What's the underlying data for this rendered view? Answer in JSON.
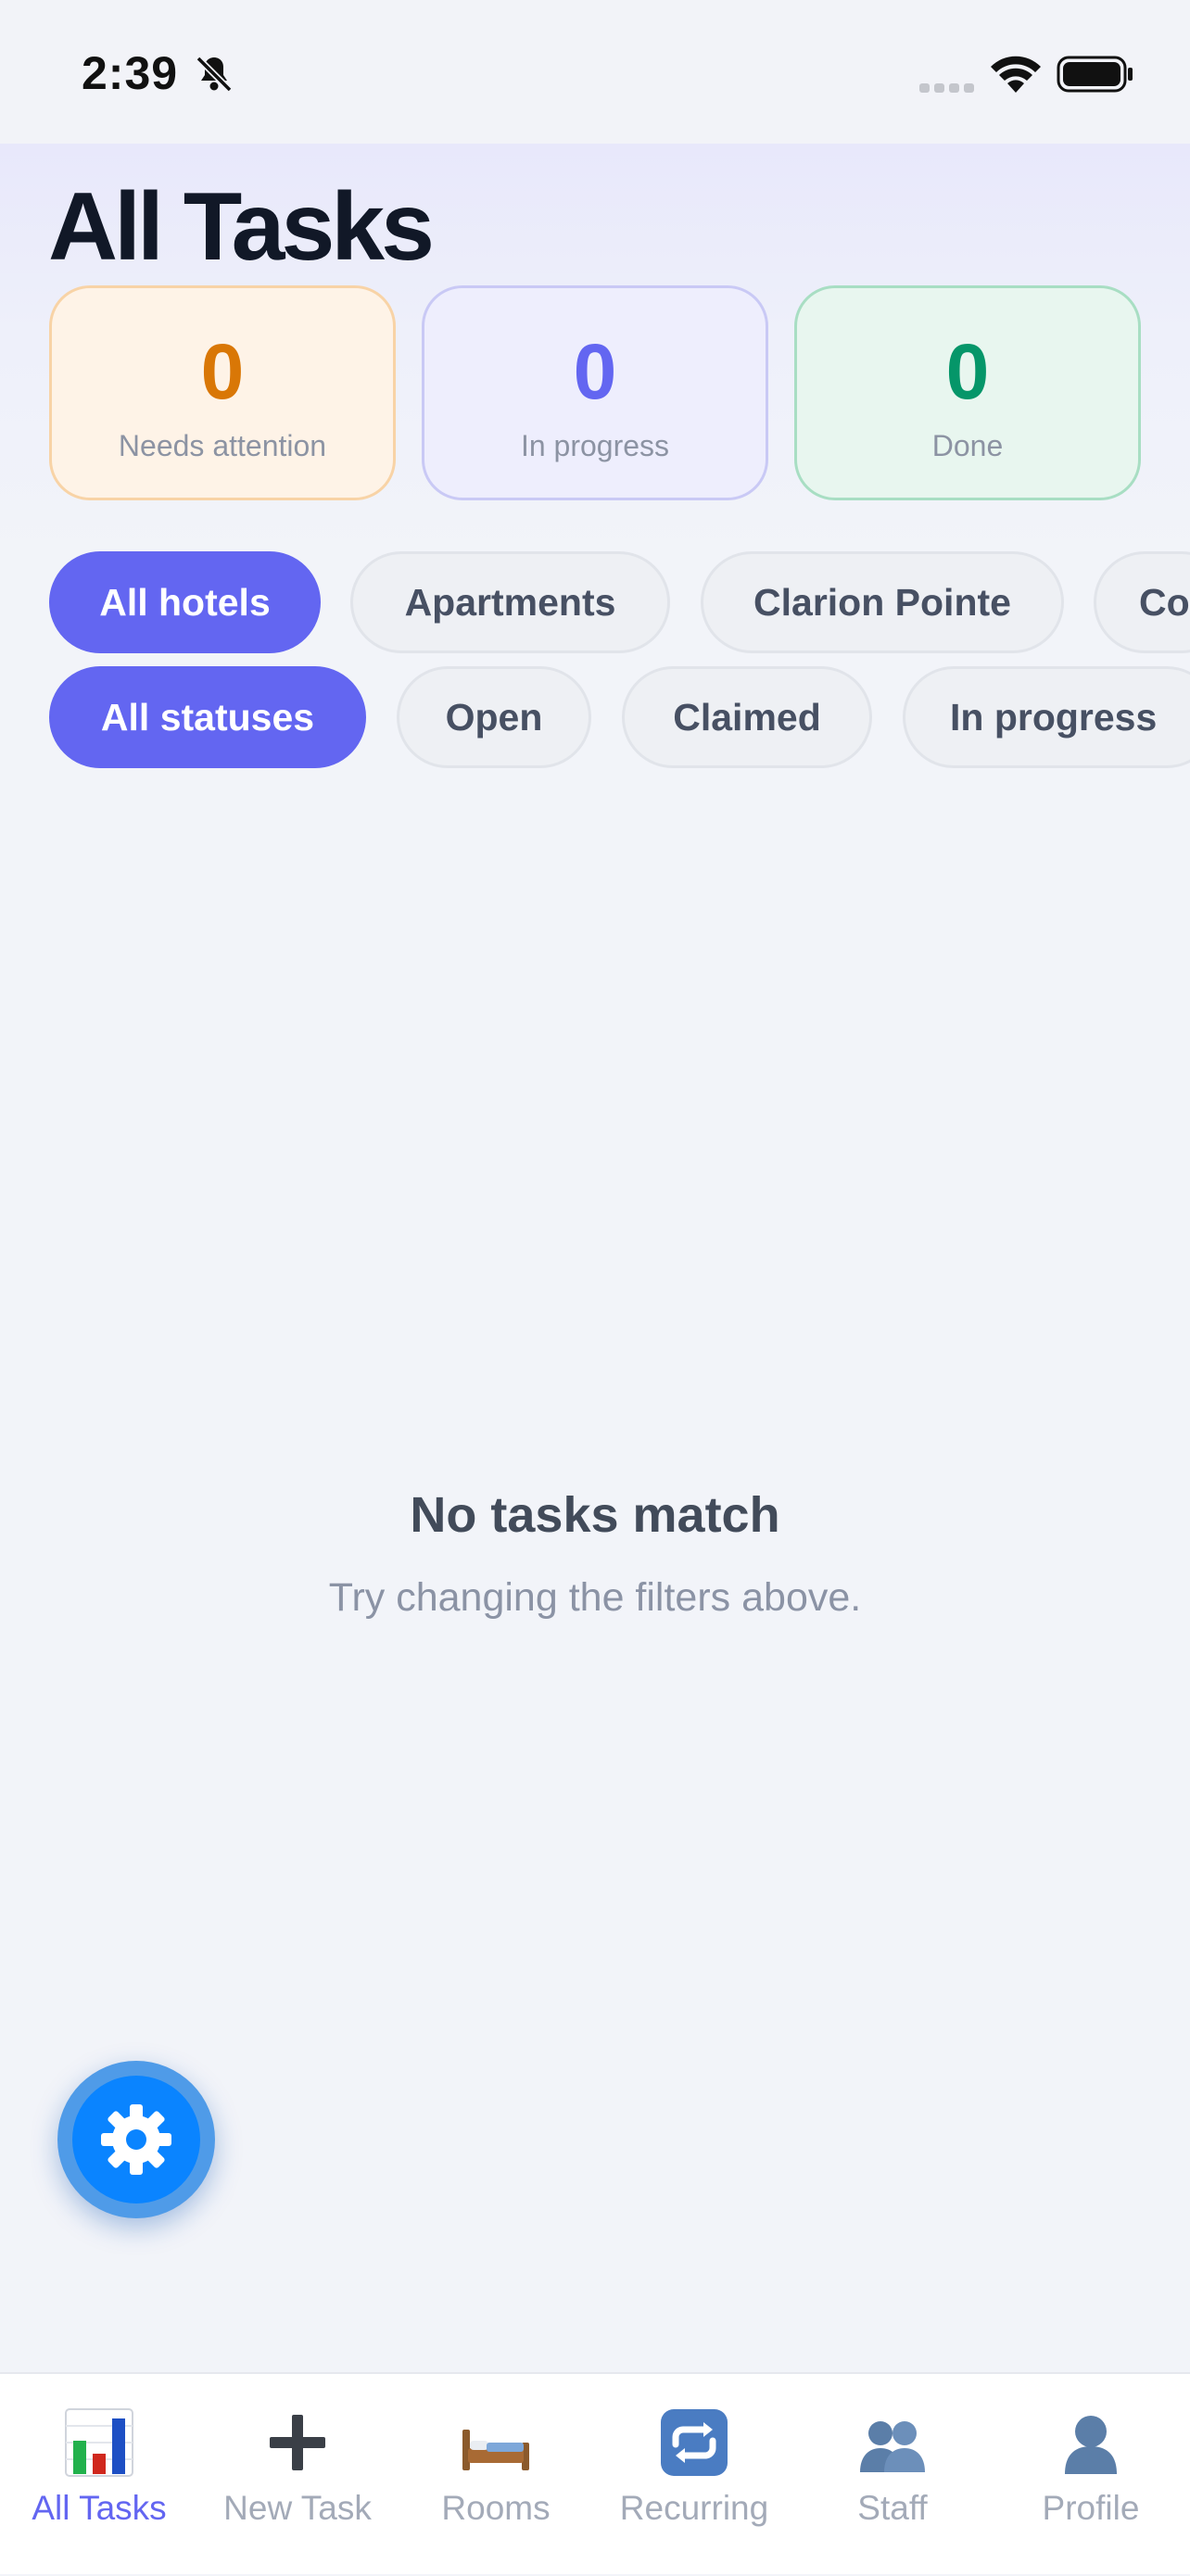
{
  "status_bar": {
    "time": "2:39"
  },
  "header": {
    "title": "All Tasks"
  },
  "stats": [
    {
      "value": "0",
      "label": "Needs attention",
      "color": "#d97706"
    },
    {
      "value": "0",
      "label": "In progress",
      "color": "#6366f1"
    },
    {
      "value": "0",
      "label": "Done",
      "color": "#059669"
    }
  ],
  "hotel_filters": {
    "selected": "All hotels",
    "options": [
      "All hotels",
      "Apartments",
      "Clarion Pointe",
      "Co"
    ]
  },
  "status_filters": {
    "selected": "All statuses",
    "options": [
      "All statuses",
      "Open",
      "Claimed",
      "In progress"
    ]
  },
  "empty_state": {
    "title": "No tasks match",
    "subtitle": "Try changing the filters above."
  },
  "fab": {
    "icon": "gear-icon"
  },
  "tabs": [
    {
      "label": "All Tasks",
      "icon": "bar-chart-icon",
      "active": true
    },
    {
      "label": "New Task",
      "icon": "plus-icon",
      "active": false
    },
    {
      "label": "Rooms",
      "icon": "bed-icon",
      "active": false
    },
    {
      "label": "Recurring",
      "icon": "repeat-icon",
      "active": false
    },
    {
      "label": "Staff",
      "icon": "people-icon",
      "active": false
    },
    {
      "label": "Profile",
      "icon": "person-icon",
      "active": false
    }
  ],
  "colors": {
    "accent": "#6366f1",
    "fab": "#0a84ff",
    "background": "#f2f4f9"
  }
}
